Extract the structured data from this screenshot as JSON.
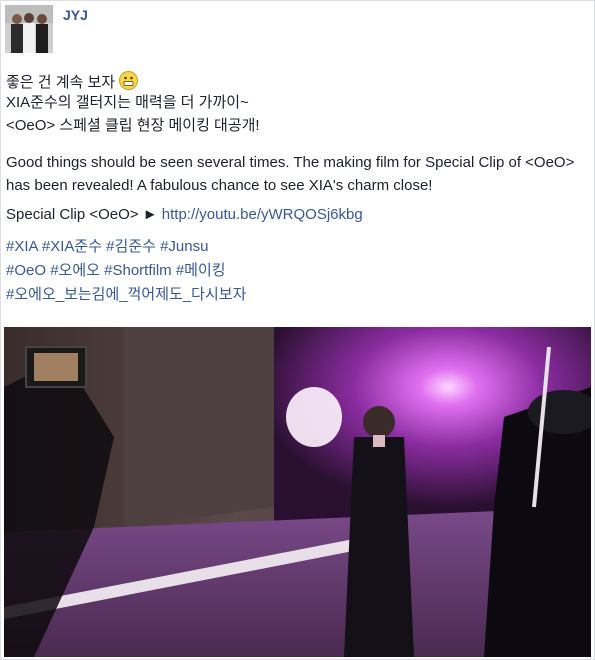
{
  "post": {
    "author": "JYJ",
    "korean_lines": [
      "좋은 건 계속 보자",
      "XIA준수의 갤터지는 매력을 더 가까이~",
      "<OeO> 스페셜 클립 현장 메이킹 대공개!"
    ],
    "emoji": "grinning-face-icon",
    "english_text": "Good things should be seen several times. The making film for Special Clip of <OeO> has been revealed! A fabulous chance to see XIA's charm close!",
    "clip_prefix": "Special Clip <OeO> ►",
    "clip_link": "http://youtu.be/yWRQOSj6kbg",
    "hashtag_lines": [
      [
        "#XIA",
        "#XIA준수",
        "#김준수",
        "#Junsu"
      ],
      [
        "#OeO",
        "#오에오",
        "#Shortfilm",
        "#메이킹"
      ],
      [
        "#오에오_보는김에_꺽어제도_다시보자"
      ]
    ]
  },
  "colors": {
    "link": "#365899",
    "text": "#1d2129",
    "border": "#dddfe2"
  }
}
